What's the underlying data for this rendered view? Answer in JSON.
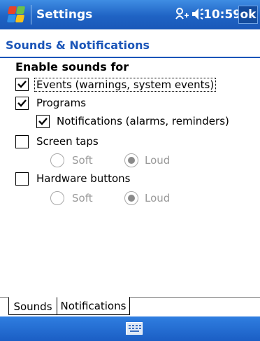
{
  "title_bar": {
    "title": "Settings",
    "time": "10:59",
    "ok_label": "ok"
  },
  "page": {
    "subtitle": "Sounds & Notifications",
    "section_heading": "Enable sounds for"
  },
  "options": {
    "events": {
      "label": "Events (warnings, system events)",
      "checked": true
    },
    "programs": {
      "label": "Programs",
      "checked": true
    },
    "notifications": {
      "label": "Notifications (alarms, reminders)",
      "checked": true
    },
    "screen_taps": {
      "label": "Screen taps",
      "checked": false,
      "soft_label": "Soft",
      "loud_label": "Loud",
      "selected": "Loud"
    },
    "hardware_buttons": {
      "label": "Hardware buttons",
      "checked": false,
      "soft_label": "Soft",
      "loud_label": "Loud",
      "selected": "Loud"
    }
  },
  "tabs": [
    {
      "label": "Sounds",
      "active": true
    },
    {
      "label": "Notifications",
      "active": false
    }
  ],
  "colors": {
    "titlebar": "#1f63c4",
    "accent_text": "#1b55b8",
    "disabled_text": "#9a9a9a"
  },
  "icons": {
    "start": "windows-flag-icon",
    "connectivity": "connectivity-icon",
    "volume": "speaker-icon",
    "keyboard": "keyboard-icon"
  }
}
